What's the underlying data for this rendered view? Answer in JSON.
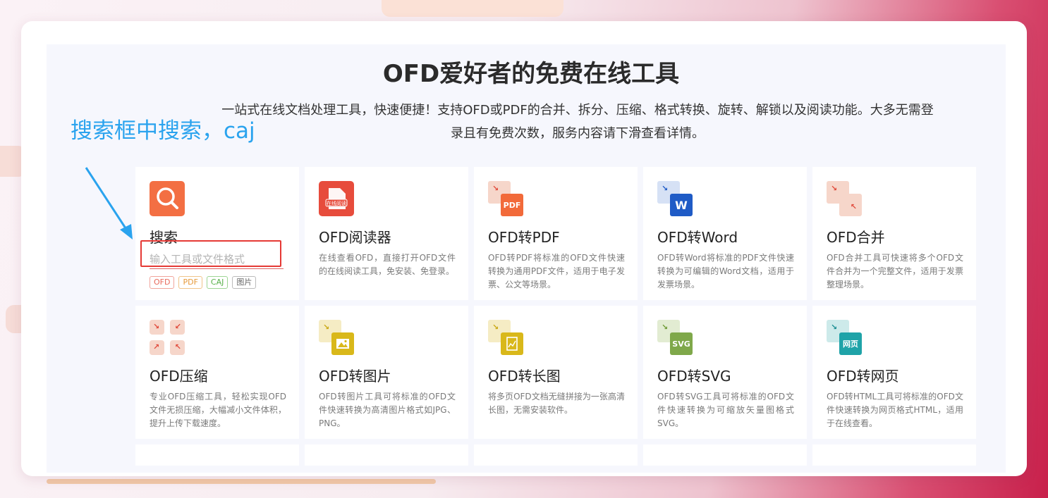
{
  "page": {
    "title": "OFD爱好者的免费在线工具",
    "description": "一站式在线文档处理工具，快速便捷！支持OFD或PDF的合并、拆分、压缩、格式转换、旋转、解锁以及阅读功能。大多无需登录且有免费次数，服务内容请下滑查看详情。"
  },
  "annotation": {
    "text": "搜索框中搜索，caj",
    "color": "#2aa3ee"
  },
  "search_card": {
    "title": "搜索",
    "placeholder": "输入工具或文件格式",
    "tags": [
      "OFD",
      "PDF",
      "CAJ",
      "图片"
    ]
  },
  "tools": [
    {
      "title": "OFD阅读器",
      "desc": "在线查看OFD，直接打开OFD文件的在线阅读工具，免安装、免登录。",
      "icon": "reader-icon",
      "badge": "在线阅读",
      "color": "#e74c3c"
    },
    {
      "title": "OFD转PDF",
      "desc": "OFD转PDF将标准的OFD文件快速转换为通用PDF文件，适用于电子发票、公文等场景。",
      "icon": "pdf-icon",
      "badge": "PDF",
      "color": "#f26a3a"
    },
    {
      "title": "OFD转Word",
      "desc": "OFD转Word将标准的PDF文件快速转换为可编辑的Word文档，适用于发票场景。",
      "icon": "word-icon",
      "badge": "W",
      "color": "#1f5bc6"
    },
    {
      "title": "OFD合并",
      "desc": "OFD合并工具可快速将多个OFD文件合并为一个完整文件，适用于发票整理场景。",
      "icon": "merge-icon",
      "badge": "",
      "color": "#e0493a"
    },
    {
      "title": "OFD压缩",
      "desc": "专业OFD压缩工具，轻松实现OFD文件无损压缩，大幅减小文件体积，提升上传下载速度。",
      "icon": "compress-icon",
      "badge": "",
      "color": "#e0493a"
    },
    {
      "title": "OFD转图片",
      "desc": "OFD转图片工具可将标准的OFD文件快速转换为高清图片格式如JPG、PNG。",
      "icon": "image-icon",
      "badge": "",
      "color": "#d9b81a"
    },
    {
      "title": "OFD转长图",
      "desc": "将多页OFD文档无缝拼接为一张高清长图，无需安装软件。",
      "icon": "long-image-icon",
      "badge": "",
      "color": "#d9b81a"
    },
    {
      "title": "OFD转SVG",
      "desc": "OFD转SVG工具可将标准的OFD文件快速转换为可缩放矢量图格式SVG。",
      "icon": "svg-icon",
      "badge": "SVG",
      "color": "#7fa84a"
    },
    {
      "title": "OFD转网页",
      "desc": "OFD转HTML工具可将标准的OFD文件快速转换为网页格式HTML，适用于在线查看。",
      "icon": "html-icon",
      "badge": "网页",
      "color": "#1fa3a8"
    }
  ]
}
